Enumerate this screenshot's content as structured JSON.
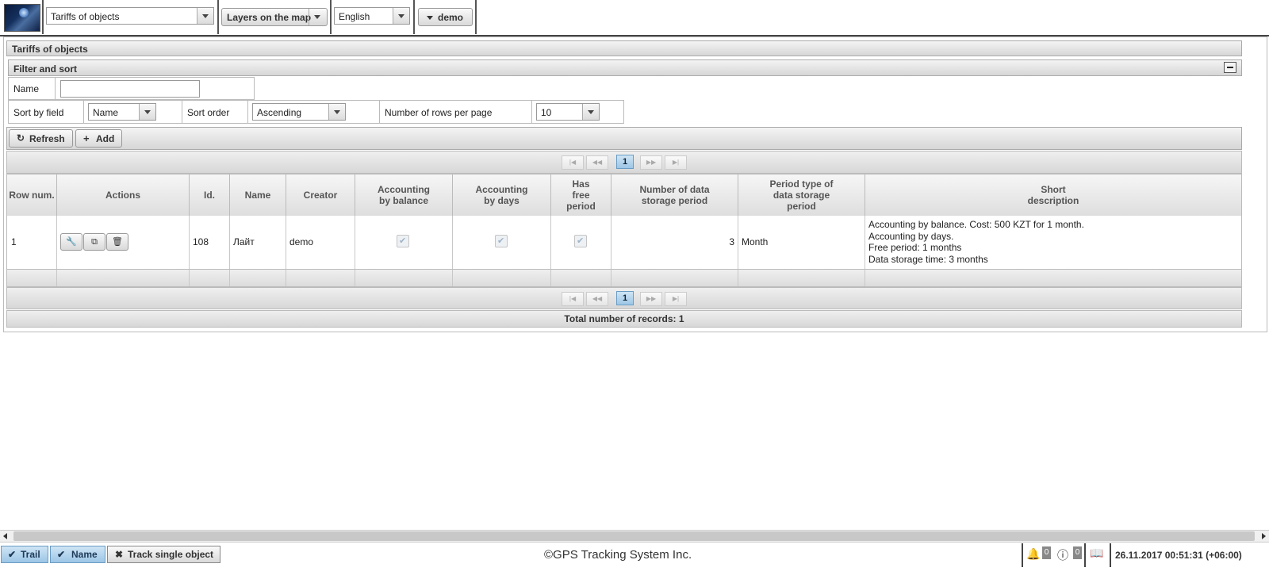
{
  "toolbar": {
    "section_select": "Tariffs of objects",
    "layers_button": "Layers on the map",
    "language_select": "English",
    "user_button": "demo"
  },
  "page": {
    "title": "Tariffs of objects"
  },
  "filter": {
    "title": "Filter and sort",
    "name_label": "Name",
    "name_value": "",
    "sort_field_label": "Sort by field",
    "sort_field_value": "Name",
    "sort_order_label": "Sort order",
    "sort_order_value": "Ascending",
    "rows_label": "Number of rows per page",
    "rows_value": "10"
  },
  "actions": {
    "refresh": "Refresh",
    "add": "Add"
  },
  "pager": {
    "current_page": "1"
  },
  "table": {
    "headers": {
      "row_num": "Row num.",
      "actions": "Actions",
      "id": "Id.",
      "name": "Name",
      "creator": "Creator",
      "acc_balance": "Accounting by balance",
      "acc_days": "Accounting by days",
      "free_period": "Has free period",
      "storage_num": "Number of data storage period",
      "storage_type": "Period type of data storage period",
      "short_desc": "Short description"
    },
    "rows": [
      {
        "row_num": "1",
        "id": "108",
        "name": "Лайт",
        "creator": "demo",
        "acc_balance": true,
        "acc_days": true,
        "free_period": true,
        "storage_num": "3",
        "storage_type": "Month",
        "desc": [
          "Accounting by balance. Cost: 500 KZT for 1 month.",
          "Accounting by days.",
          "Free period: 1 months",
          "Data storage time: 3 months"
        ]
      }
    ],
    "total": "Total number of records: 1"
  },
  "footer": {
    "trail": "Trail",
    "name": "Name",
    "track_single": "Track single object",
    "copyright": "©GPS Tracking System Inc.",
    "notifications_count": "0",
    "info_count": "0",
    "datetime": "26.11.2017 00:51:31 (+06:00)"
  }
}
